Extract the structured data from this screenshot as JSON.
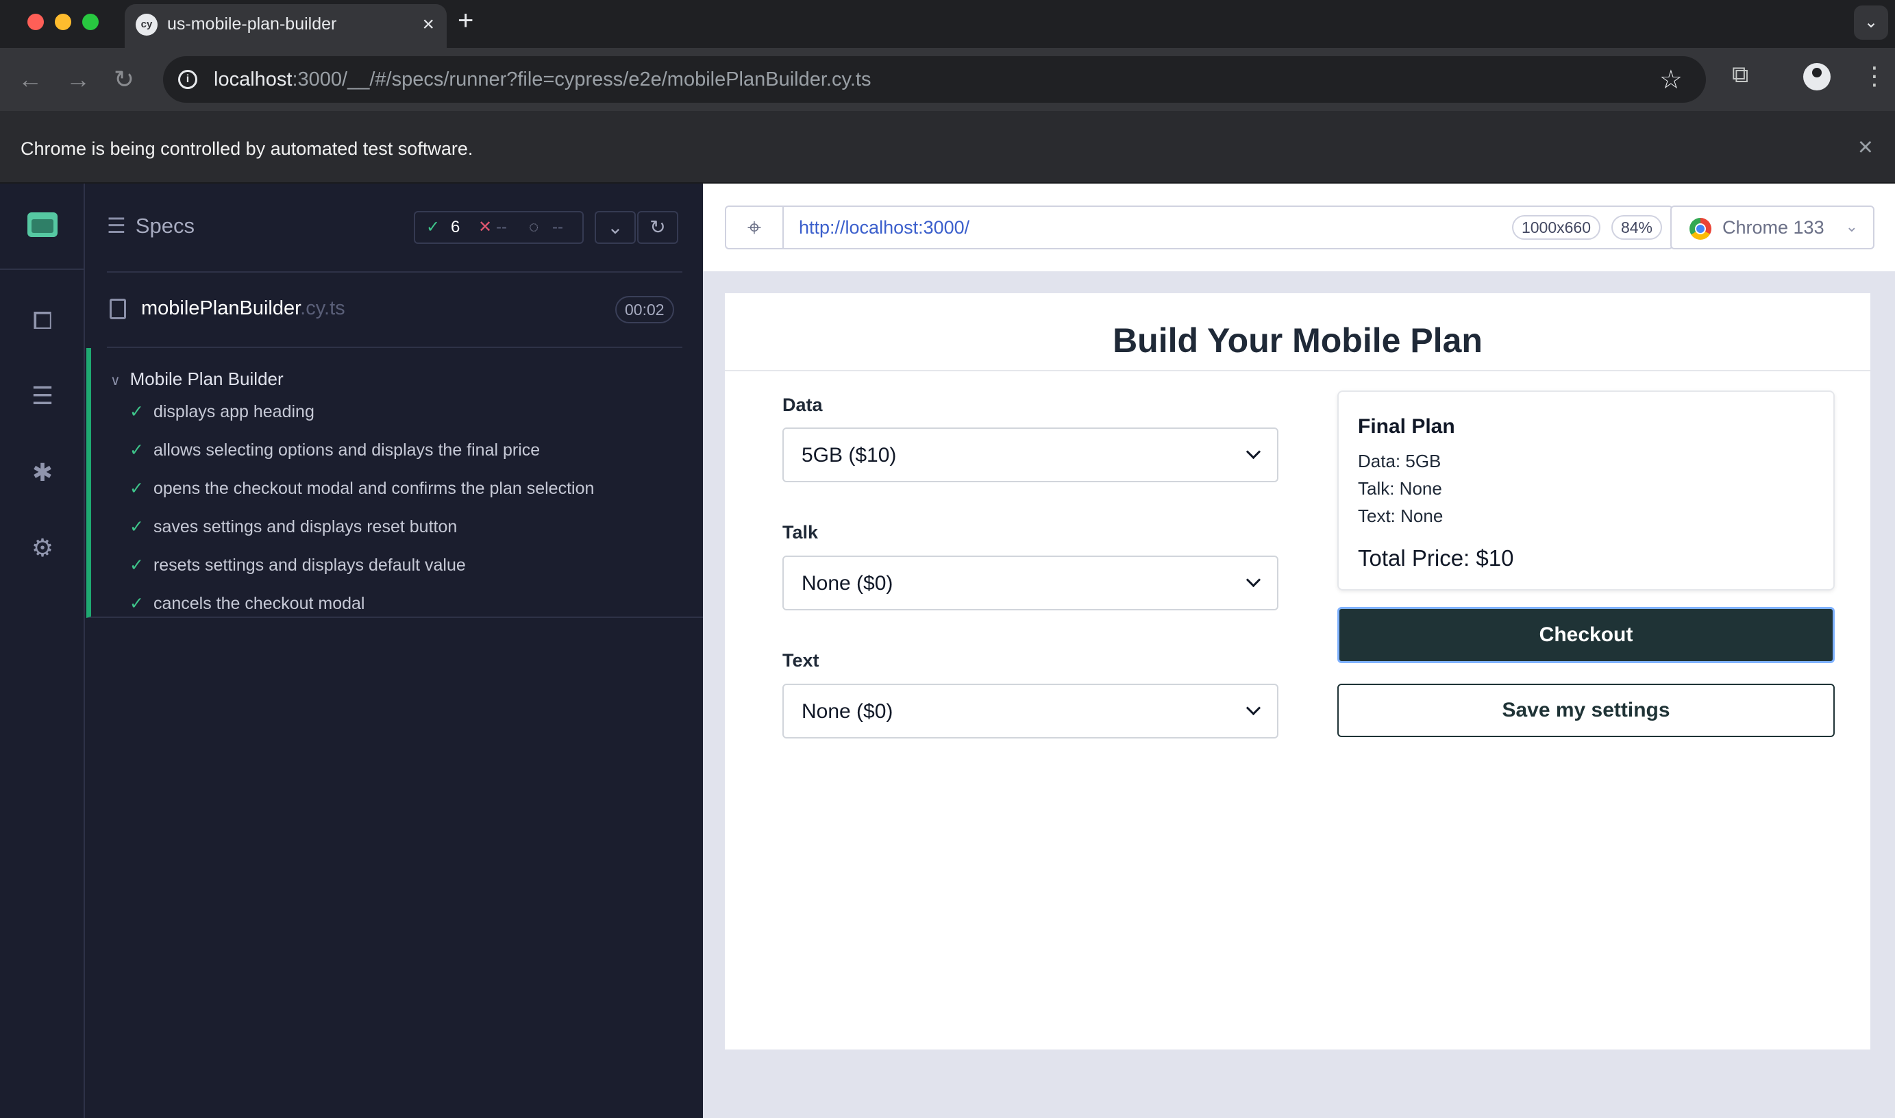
{
  "browser": {
    "tab_title": "us-mobile-plan-builder",
    "tab_favicon": "cy",
    "tab_close": "×",
    "new_tab": "+",
    "tab_menu": "⌄",
    "url_host": "localhost",
    "url_rest": ":3000/__/#/specs/runner?file=cypress/e2e/mobilePlanBuilder.cy.ts",
    "infobar_text": "Chrome is being controlled by automated test software.",
    "infobar_close": "×",
    "icons": [
      "back-arrow-icon",
      "forward-arrow-icon",
      "reload-icon",
      "info-icon",
      "star-icon",
      "extensions-icon",
      "profile-icon",
      "more-icon"
    ],
    "traffic_colors": [
      "#ff5f57",
      "#febc2e",
      "#28c840"
    ]
  },
  "reporter": {
    "header": "Specs",
    "stats": {
      "passed": "6",
      "failed": "--",
      "pending": "--"
    },
    "spec_file": "mobilePlanBuilder",
    "spec_ext": ".cy.ts",
    "duration": "00:02",
    "suite": "Mobile Plan Builder",
    "tests": [
      "displays app heading",
      "allows selecting options and displays the final price",
      "opens the checkout modal and confirms the plan selection",
      "saves settings and displays reset button",
      "resets settings and displays default value",
      "cancels the checkout modal"
    ],
    "pass_color": "#1fa971"
  },
  "aut": {
    "url": "http://localhost:3000/",
    "viewport": "1000x660",
    "zoom": "84%",
    "browser": "Chrome 133"
  },
  "app": {
    "title": "Build Your Mobile Plan",
    "fields": [
      {
        "label": "Data",
        "value": "5GB ($10)"
      },
      {
        "label": "Talk",
        "value": "None ($0)"
      },
      {
        "label": "Text",
        "value": "None ($0)"
      }
    ],
    "summary": {
      "title": "Final Plan",
      "lines": [
        "Data: 5GB",
        "Talk: None",
        "Text: None"
      ],
      "total": "Total Price: $10"
    },
    "checkout_label": "Checkout",
    "save_label": "Save my settings",
    "button_color": "#1f3336"
  }
}
